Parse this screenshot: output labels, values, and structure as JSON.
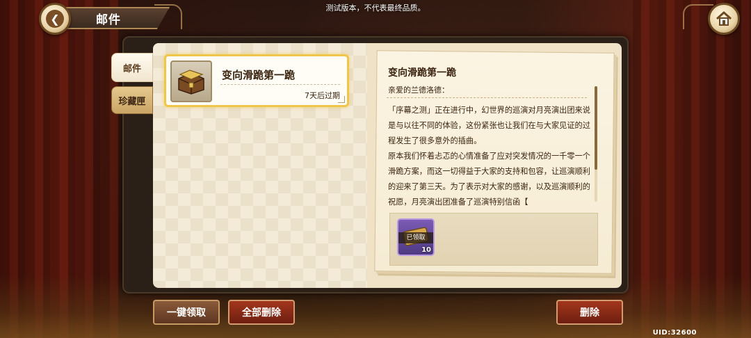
{
  "notice": "测试版本，不代表最终品质。",
  "header": {
    "title": "邮件"
  },
  "tabs": [
    {
      "label": "邮件"
    },
    {
      "label": "珍藏匣"
    }
  ],
  "mail_list": [
    {
      "title": "变向滑跪第一跪",
      "expire": "7天后过期",
      "icon": "treasure-chest-icon"
    }
  ],
  "letter": {
    "title": "变向滑跪第一跪",
    "greeting": "亲爱的兰德洛德：",
    "body": "「序幕之测」正在进行中，幻世界的巡演对月亮演出团来说是与以往不同的体验，这份紧张也让我们在与大家见证的过程发生了很多意外的插曲。\n原本我们怀着忐忑的心情准备了应对突发情况的一千零一个滑跪方案，而这一切得益于大家的支持和包容，让巡演顺利的迎来了第三天。为了表示对大家的感谢，以及巡演顺利的祝愿，月亮演出团准备了巡演特别信函【",
    "attachment": {
      "status": "已领取",
      "count": "10",
      "icon": "gold-ticket-icon"
    }
  },
  "buttons": {
    "claim_all": "一键领取",
    "delete_all": "全部删除",
    "delete": "删除"
  },
  "uid": "UID:32600"
}
